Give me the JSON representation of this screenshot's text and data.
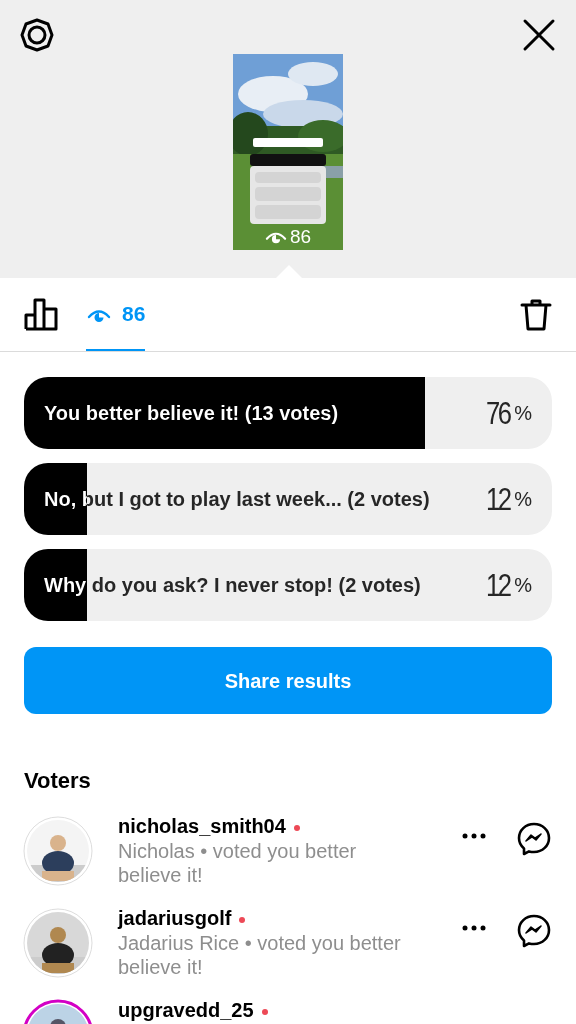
{
  "story": {
    "views": "86"
  },
  "toolbar": {
    "tabs": [
      {
        "kind": "results",
        "selected": false
      },
      {
        "kind": "viewers",
        "label": "86",
        "selected": true
      }
    ]
  },
  "poll": {
    "options": [
      {
        "label": "You better believe it! (13 votes)",
        "level": 0.76,
        "percent": "76",
        "unit": "%"
      },
      {
        "label": "No, but I got to play last week... (2 votes)",
        "level": 0.12,
        "percent": "12",
        "unit": "%"
      },
      {
        "label": "Why do you ask? I never stop! (2 votes)",
        "level": 0.12,
        "percent": "12",
        "unit": "%"
      }
    ]
  },
  "share_button": "Share results",
  "voters": {
    "title": "Voters",
    "items": [
      {
        "username": "nicholas_smith04",
        "new": true,
        "story_ring": false,
        "subtitle": "Nicholas • voted you better believe it!"
      },
      {
        "username": "jadariusgolf",
        "new": true,
        "story_ring": false,
        "subtitle": "Jadarius Rice • voted you better believe it!"
      },
      {
        "username": "upgravedd_25",
        "new": true,
        "story_ring": true
      }
    ]
  }
}
